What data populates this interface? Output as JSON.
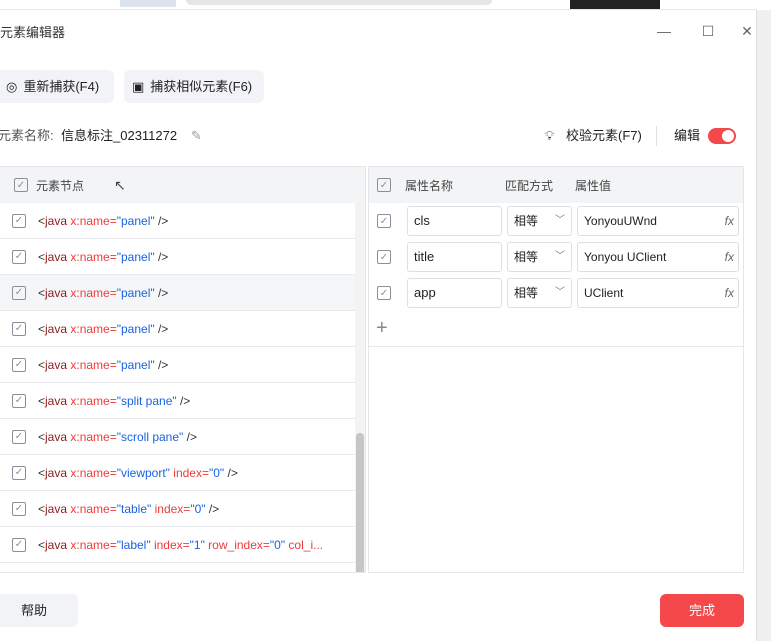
{
  "window": {
    "title": "元素编辑器",
    "minimize": "—",
    "maximize": "☐",
    "close": "✕"
  },
  "toolbar": {
    "recapture": "重新捕获(F4)",
    "capture_similar": "捕获相似元素(F6)"
  },
  "element": {
    "name_label": "元素名称:",
    "name_value": "信息标注_02311272",
    "validate": "校验元素(F7)",
    "edit_label": "编辑",
    "edit_on": true
  },
  "colors": {
    "accent": "#f5484b",
    "tag": "#8b1c1c",
    "attr": "#ee3b3b",
    "value": "#1a63e0"
  },
  "nodes": {
    "header": "元素节点",
    "rows": [
      [
        {
          "t": "<",
          "c": "k3"
        },
        {
          "t": "java ",
          "c": "k0"
        },
        {
          "t": "x:name=",
          "c": "k1"
        },
        {
          "t": "\"panel\"",
          "c": "k2"
        },
        {
          "t": " />",
          "c": "k3"
        }
      ],
      [
        {
          "t": "<",
          "c": "k3"
        },
        {
          "t": "java ",
          "c": "k0"
        },
        {
          "t": "x:name=",
          "c": "k1"
        },
        {
          "t": "\"panel\"",
          "c": "k2"
        },
        {
          "t": " />",
          "c": "k3"
        }
      ],
      [
        {
          "t": "<",
          "c": "k3"
        },
        {
          "t": "java ",
          "c": "k0"
        },
        {
          "t": "x:name=",
          "c": "k1"
        },
        {
          "t": "\"panel\"",
          "c": "k2"
        },
        {
          "t": " />",
          "c": "k3"
        }
      ],
      [
        {
          "t": "<",
          "c": "k3"
        },
        {
          "t": "java ",
          "c": "k0"
        },
        {
          "t": "x:name=",
          "c": "k1"
        },
        {
          "t": "\"panel\"",
          "c": "k2"
        },
        {
          "t": " />",
          "c": "k3"
        }
      ],
      [
        {
          "t": "<",
          "c": "k3"
        },
        {
          "t": "java ",
          "c": "k0"
        },
        {
          "t": "x:name=",
          "c": "k1"
        },
        {
          "t": "\"panel\"",
          "c": "k2"
        },
        {
          "t": " />",
          "c": "k3"
        }
      ],
      [
        {
          "t": "<",
          "c": "k3"
        },
        {
          "t": "java ",
          "c": "k0"
        },
        {
          "t": "x:name=",
          "c": "k1"
        },
        {
          "t": "\"split pane\"",
          "c": "k2"
        },
        {
          "t": " />",
          "c": "k3"
        }
      ],
      [
        {
          "t": "<",
          "c": "k3"
        },
        {
          "t": "java ",
          "c": "k0"
        },
        {
          "t": "x:name=",
          "c": "k1"
        },
        {
          "t": "\"scroll pane\"",
          "c": "k2"
        },
        {
          "t": " />",
          "c": "k3"
        }
      ],
      [
        {
          "t": "<",
          "c": "k3"
        },
        {
          "t": "java ",
          "c": "k0"
        },
        {
          "t": "x:name=",
          "c": "k1"
        },
        {
          "t": "\"viewport\"",
          "c": "k2"
        },
        {
          "t": " index=",
          "c": "k1"
        },
        {
          "t": "\"0\"",
          "c": "k2"
        },
        {
          "t": " />",
          "c": "k3"
        }
      ],
      [
        {
          "t": "<",
          "c": "k3"
        },
        {
          "t": "java ",
          "c": "k0"
        },
        {
          "t": "x:name=",
          "c": "k1"
        },
        {
          "t": "\"table\"",
          "c": "k2"
        },
        {
          "t": " index=",
          "c": "k1"
        },
        {
          "t": "\"0\"",
          "c": "k2"
        },
        {
          "t": " />",
          "c": "k3"
        }
      ],
      [
        {
          "t": "<",
          "c": "k3"
        },
        {
          "t": "java ",
          "c": "k0"
        },
        {
          "t": "x:name=",
          "c": "k1"
        },
        {
          "t": "\"label\"",
          "c": "k2"
        },
        {
          "t": " index=",
          "c": "k1"
        },
        {
          "t": "\"1\"",
          "c": "k2"
        },
        {
          "t": " row_index=",
          "c": "k1"
        },
        {
          "t": "\"0\"",
          "c": "k2"
        },
        {
          "t": " col_i...",
          "c": "k1"
        }
      ]
    ]
  },
  "attributes": {
    "header": {
      "name": "属性名称",
      "match": "匹配方式",
      "value": "属性值"
    },
    "rows": [
      {
        "name": "cls",
        "match": "相等",
        "value": "YonyouUWnd"
      },
      {
        "name": "title",
        "match": "相等",
        "value": "Yonyou UClient"
      },
      {
        "name": "app",
        "match": "相等",
        "value": "UClient"
      }
    ],
    "add": "+",
    "fx": "fx"
  },
  "footer": {
    "help": "帮助",
    "done": "完成"
  }
}
